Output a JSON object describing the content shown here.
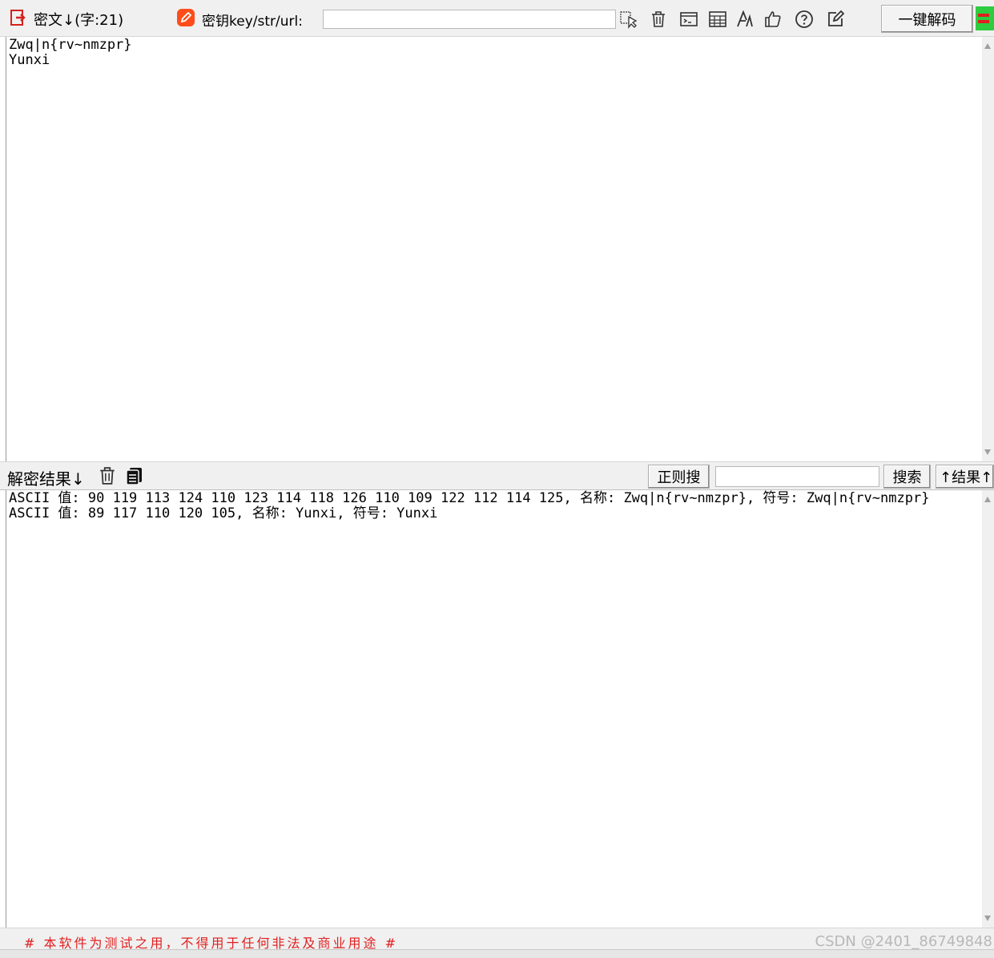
{
  "toolbar": {
    "ciphertext_label": "密文↓(字:21)",
    "key_label": "密钥key/str/url:",
    "key_value": "",
    "decode_button": "一键解码",
    "icons": [
      "cursor-icon",
      "trash-icon",
      "terminal-icon",
      "table-icon",
      "font-icon",
      "thumbs-up-icon",
      "help-icon",
      "edit-icon"
    ]
  },
  "cipher": {
    "text": "Zwq|n{rv~nmzpr}\nYunxi"
  },
  "result_bar": {
    "label": "解密结果↓",
    "regex_button": "正则搜",
    "search_value": "",
    "search_button": "搜索",
    "up_result_button": "↑结果↑"
  },
  "result": {
    "text": "ASCII 值: 90 119 113 124 110 123 114 118 126 110 109 122 112 114 125, 名称: Zwq|n{rv~nmzpr}, 符号: Zwq|n{rv~nmzpr}\nASCII 值: 89 117 110 120 105, 名称: Yunxi, 符号: Yunxi"
  },
  "footer": {
    "disclaimer": "# 本软件为测试之用，不得用于任何非法及商业用途 #",
    "watermark": "CSDN @2401_86749848"
  },
  "colors": {
    "accent_red": "#e02020",
    "orange": "#ff4d1a",
    "green": "#2ecc40"
  }
}
